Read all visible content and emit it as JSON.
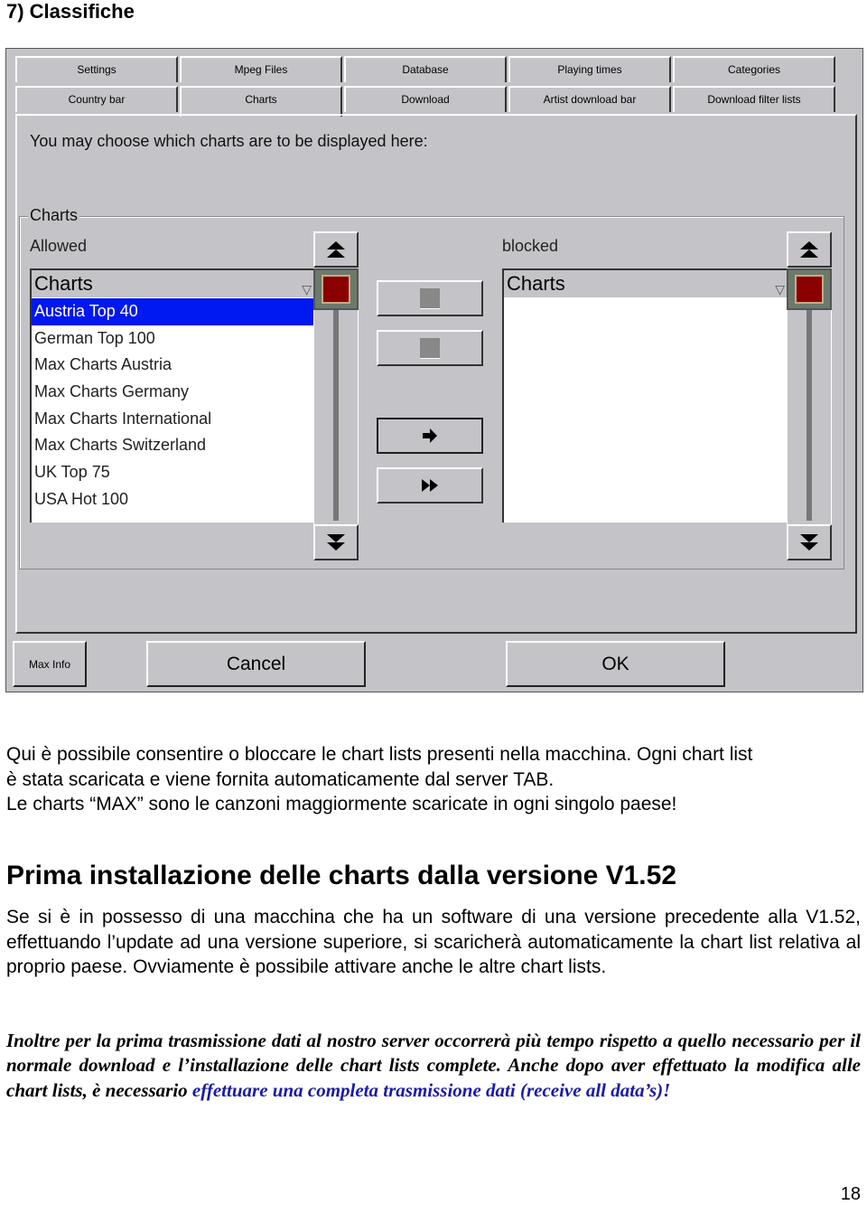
{
  "section_title": "7) Classifiche",
  "app": {
    "tabs_row1": [
      "Settings",
      "Mpeg Files",
      "Database",
      "Playing times",
      "Categories"
    ],
    "tabs_row2": [
      "Country bar",
      "Charts",
      "Download",
      "Artist download bar",
      "Download filter lists"
    ],
    "active_tab": "Charts",
    "intro_text": "You may choose which charts are to be displayed here:",
    "group_label": "Charts",
    "allowed": {
      "label": "Allowed",
      "header": "Charts",
      "items": [
        "Austria Top 40",
        "German Top 100",
        "Max Charts Austria",
        "Max Charts Germany",
        "Max Charts International",
        "Max Charts Switzerland",
        "UK Top 75",
        "USA Hot 100"
      ],
      "selected": "Austria Top 40"
    },
    "blocked": {
      "label": "blocked",
      "header": "Charts",
      "items": []
    },
    "icons": {
      "scroll_top": "⏶",
      "dropdown": "▽",
      "move_right": "➜",
      "move_all_right": "▶▶"
    },
    "buttons": {
      "max_info": "Max Info",
      "cancel": "Cancel",
      "ok": "OK"
    },
    "colors": {
      "selection": "#0018f0",
      "thumb": "#8b0000",
      "window_bg": "#c4c4c8"
    }
  },
  "paragraph1": [
    "Qui è possibile consentire o bloccare le chart lists presenti nella macchina. Ogni chart list",
    "è stata scaricata e viene fornita automaticamente dal server TAB.",
    "Le charts “MAX” sono le canzoni maggiormente scaricate in ogni singolo paese!"
  ],
  "heading2": "Prima installazione delle charts dalla versione V1.52",
  "paragraph2": "Se si è in possesso di una macchina che ha un software di una versione precedente alla V1.52, effettuando l’update ad una versione superiore, si scaricherà automaticamente la chart list relativa al proprio paese. Ovviamente è possibile attivare anche le altre chart lists.",
  "paragraph3": {
    "text": "Inoltre per la prima trasmissione dati al nostro server occorrerà più tempo rispetto a quello necessario per il normale download e l’installazione delle chart lists complete. Anche dopo aver effettuato la modifica alle chart lists, è necessario ",
    "highlight": "effettuare una completa trasmissione dati (receive all data’s)!"
  },
  "page_number": "18"
}
